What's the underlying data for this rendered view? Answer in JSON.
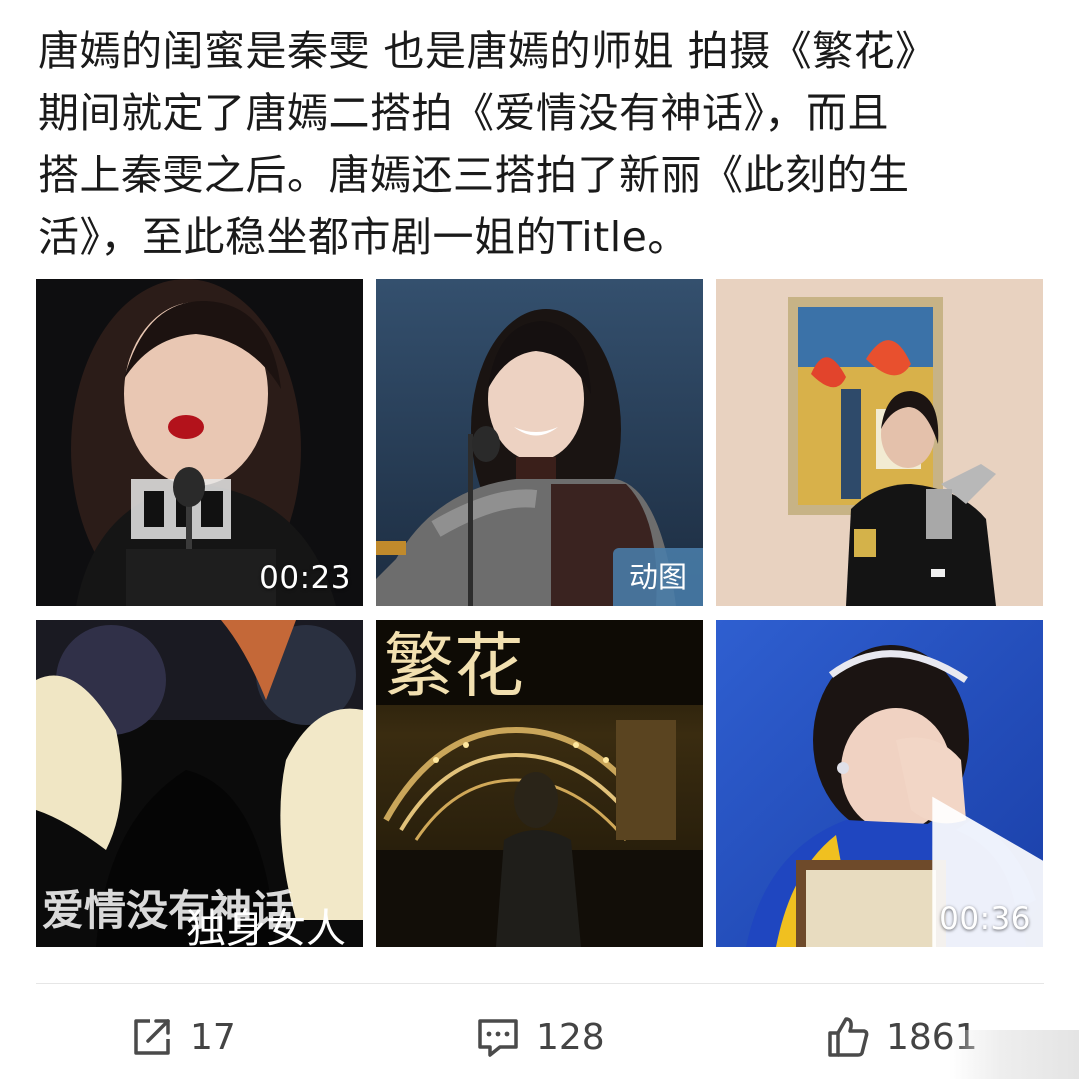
{
  "post": {
    "text_lines": [
      "唐嫣的闺蜜是秦雯 也是唐嫣的师姐 拍摄《繁花》",
      "期间就定了唐嫣二搭拍《爱情没有神话》，而且",
      "搭上秦雯之后。唐嫣还三搭拍了新丽《此刻的生",
      "活》，至此稳坐都市剧一姐的Title。"
    ]
  },
  "media": [
    {
      "kind": "video",
      "badge": "00:23",
      "icon": "photo-thumbnail"
    },
    {
      "kind": "gif",
      "badge": "动图",
      "icon": "photo-thumbnail"
    },
    {
      "kind": "image",
      "badge": "",
      "icon": "photo-thumbnail"
    },
    {
      "kind": "image",
      "badge": "",
      "icon": "poster-thumbnail",
      "caption_main": "爱情没有神话",
      "caption_script": "独身女人"
    },
    {
      "kind": "image",
      "badge": "",
      "icon": "poster-thumbnail",
      "caption_main": "繁花"
    },
    {
      "kind": "video",
      "badge": "00:36",
      "icon": "play-icon"
    }
  ],
  "actions": {
    "share": {
      "icon": "share-icon",
      "count": "17"
    },
    "comment": {
      "icon": "comment-icon",
      "count": "128"
    },
    "like": {
      "icon": "thumbs-up-icon",
      "count": "1861"
    }
  },
  "colors": {
    "gif_badge": "#497daa",
    "text": "#1a1a1a",
    "action_icon": "#444444"
  }
}
